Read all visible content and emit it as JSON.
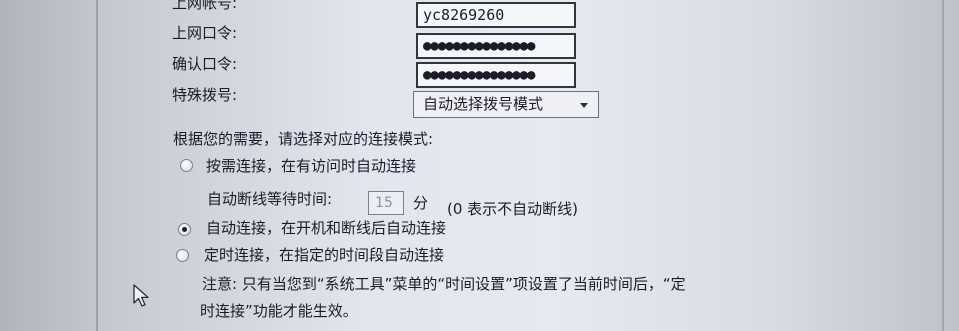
{
  "account": {
    "username_label": "上网帐号:",
    "username_value": "yc8269260",
    "password_label": "上网口令:",
    "password_value": "●●●●●●●●●●●●●●●",
    "confirm_label": "确认口令:",
    "confirm_value": "●●●●●●●●●●●●●●●",
    "dial_label": "特殊拨号:",
    "dial_selected": "自动选择拨号模式"
  },
  "connection": {
    "heading": "根据您的需要，请选择对应的连接模式:",
    "selected_mode": "auto",
    "modes": [
      {
        "id": "on-demand",
        "label": "按需连接，在有访问时自动连接"
      },
      {
        "id": "auto",
        "label": "自动连接，在开机和断线后自动连接"
      },
      {
        "id": "timed",
        "label": "定时连接，在指定的时间段自动连接"
      }
    ],
    "wait_label": "自动断线等待时间:",
    "wait_value": "15",
    "wait_unit": "分",
    "wait_hint": "(0 表示不自动断线)",
    "note_line1": "注意: 只有当您到“系统工具”菜单的“时间设置”项设置了当前时间后，“定",
    "note_line2": "时连接”功能才能生效。"
  },
  "icons": {
    "select_arrow": "chevron-down-icon",
    "cursor": "mouse-pointer-icon"
  },
  "colors": {
    "text": "#1c1c28",
    "panel": "#e4e7f0",
    "input_border": "#33363d"
  }
}
